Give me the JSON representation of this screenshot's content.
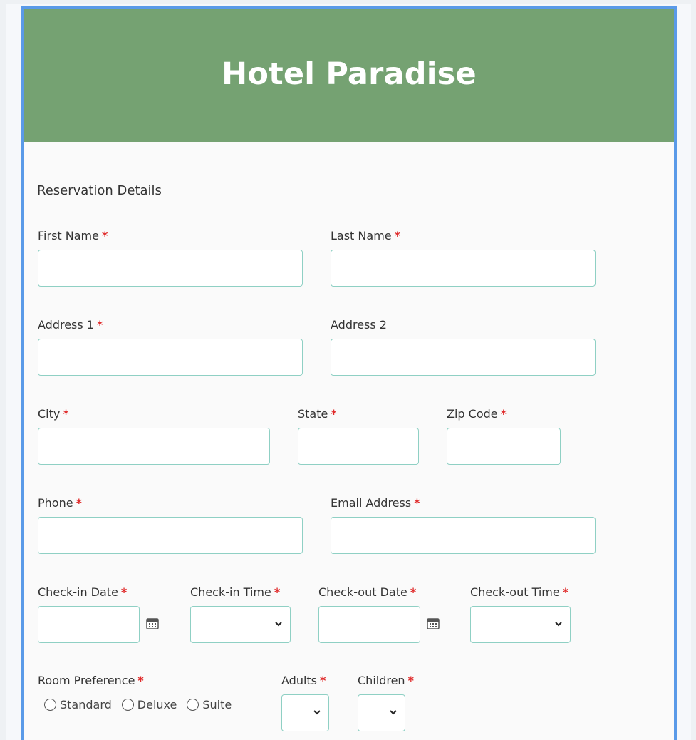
{
  "header": {
    "title": "Hotel Paradise"
  },
  "section": {
    "title": "Reservation Details"
  },
  "required_mark": "*",
  "fields": {
    "first_name": "First Name",
    "last_name": "Last Name",
    "address1": "Address 1",
    "address2": "Address 2",
    "city": "City",
    "state": "State",
    "zip": "Zip Code",
    "phone": "Phone",
    "email": "Email Address",
    "checkin_date": "Check-in Date",
    "checkin_time": "Check-in Time",
    "checkout_date": "Check-out Date",
    "checkout_time": "Check-out Time",
    "room_pref": "Room Preference",
    "adults": "Adults",
    "children": "Children"
  },
  "room_options": [
    "Standard",
    "Deluxe",
    "Suite"
  ],
  "icons": {
    "calendar": "calendar-icon",
    "dropdown": "chevron-down-icon"
  },
  "colors": {
    "header_bg": "#75a272",
    "border": "#5a9ae8",
    "input_border": "#8fd0c4",
    "required": "#e02a2a"
  }
}
